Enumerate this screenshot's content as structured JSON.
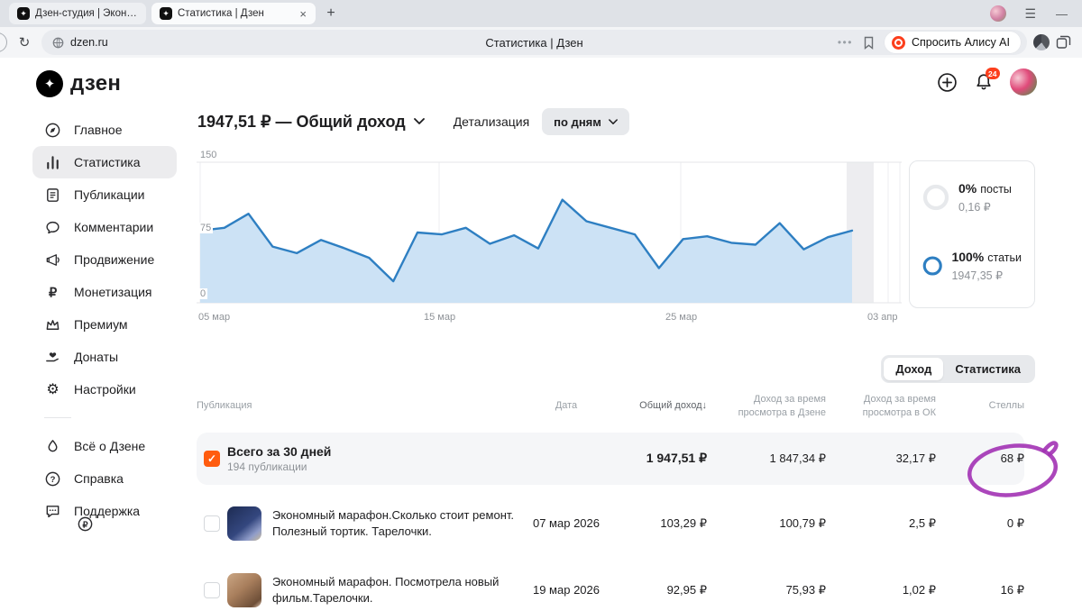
{
  "browser": {
    "tab1": "Дзен-студия | Экономны",
    "tab2": "Статистика | Дзен",
    "url": "dzen.ru",
    "page_title": "Статистика | Дзен",
    "alice_button": "Спросить Алису AI"
  },
  "topbar": {
    "notification_count": "24"
  },
  "sidebar": {
    "logo_text": "дзен",
    "items": [
      {
        "label": "Главное"
      },
      {
        "label": "Статистика"
      },
      {
        "label": "Публикации"
      },
      {
        "label": "Комментарии"
      },
      {
        "label": "Продвижение"
      },
      {
        "label": "Монетизация"
      },
      {
        "label": "Премиум"
      },
      {
        "label": "Донаты"
      },
      {
        "label": "Настройки"
      }
    ],
    "secondary": [
      {
        "label": "Всё о Дзене"
      },
      {
        "label": "Справка"
      },
      {
        "label": "Поддержка"
      }
    ]
  },
  "header": {
    "income_title": "1947,51 ₽ — Общий доход",
    "detail_label": "Детализация",
    "period_value": "по дням"
  },
  "chart_data": {
    "type": "area",
    "title": "Общий доход по дням",
    "x_ticks": [
      "05 мар",
      "15 мар",
      "25 мар",
      "03 апр"
    ],
    "y_ticks": [
      "0",
      "75",
      "150"
    ],
    "ylim": [
      0,
      150
    ],
    "values": [
      77,
      80,
      95,
      60,
      53,
      67,
      58,
      48,
      23,
      75,
      73,
      80,
      63,
      72,
      58,
      110,
      87,
      80,
      73,
      37,
      68,
      71,
      64,
      62,
      85,
      57,
      70,
      77
    ],
    "line_color": "#2e7fc2",
    "fill_color": "#cce2f5",
    "legend": "none",
    "grid": "vertical"
  },
  "summary_card": {
    "posts_percent": "0%",
    "posts_label": "посты",
    "posts_value": "0,16 ₽",
    "articles_percent": "100%",
    "articles_label": "статьи",
    "articles_value": "1947,35 ₽"
  },
  "view_tabs": {
    "income": "Доход",
    "stats": "Статистика"
  },
  "table": {
    "headers": {
      "publication": "Публикация",
      "date": "Дата",
      "total": "Общий доход",
      "zen": "Доход за время просмотра в Дзене",
      "ok": "Доход за время просмотра в ОК",
      "stells": "Стеллы"
    },
    "summary": {
      "title": "Всего за 30 дней",
      "subtitle": "194 публикации",
      "total": "1 947,51 ₽",
      "zen": "1 847,34 ₽",
      "ok": "32,17 ₽",
      "stells": "68 ₽"
    },
    "rows": [
      {
        "title": "Экономный марафон.Сколько стоит ремонт. Полезный тортик. Тарелочки.",
        "date": "07 мар 2026",
        "total": "103,29 ₽",
        "zen": "100,79 ₽",
        "ok": "2,5 ₽",
        "stells": "0 ₽"
      },
      {
        "title": "Экономный марафон. Посмотрела новый фильм.Тарелочки.",
        "date": "19 мар 2026",
        "total": "92,95 ₽",
        "zen": "75,93 ₽",
        "ok": "1,02 ₽",
        "stells": "16 ₽"
      }
    ]
  },
  "colors": {
    "accent_blue": "#2e7fc2",
    "checkbox_orange": "#ff5c0f",
    "annotation_purple": "#a232b4",
    "badge_red": "#fc3f1d"
  }
}
